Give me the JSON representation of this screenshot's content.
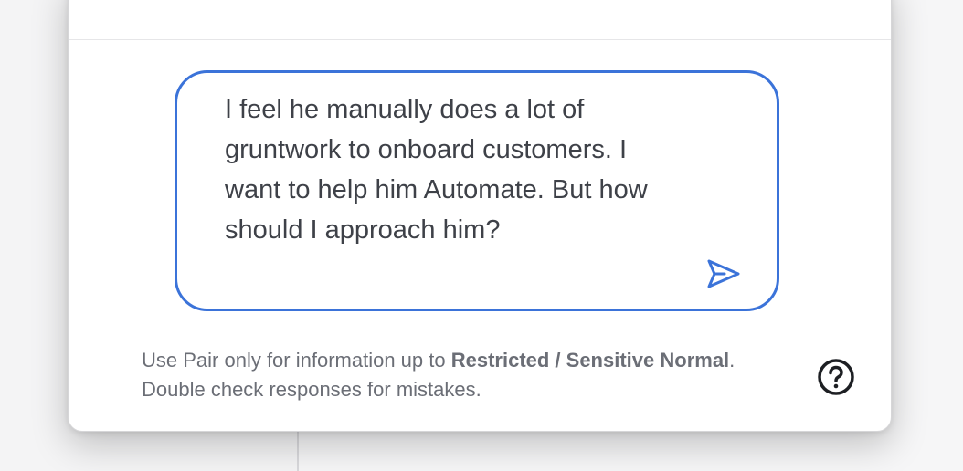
{
  "composer": {
    "message": "I feel he manually does a lot of gruntwork to onboard customers. I want to help him Automate. But how should I approach him?"
  },
  "disclaimer": {
    "prefix": "Use Pair only for information up to ",
    "classification": "Restricted / Sensitive Normal",
    "suffix": ". Double check responses for mistakes."
  },
  "icons": {
    "send": "send-icon",
    "help": "help-circle-icon"
  },
  "colors": {
    "accent": "#3b73d9",
    "text": "#3e4148",
    "muted": "#6b6e76"
  }
}
